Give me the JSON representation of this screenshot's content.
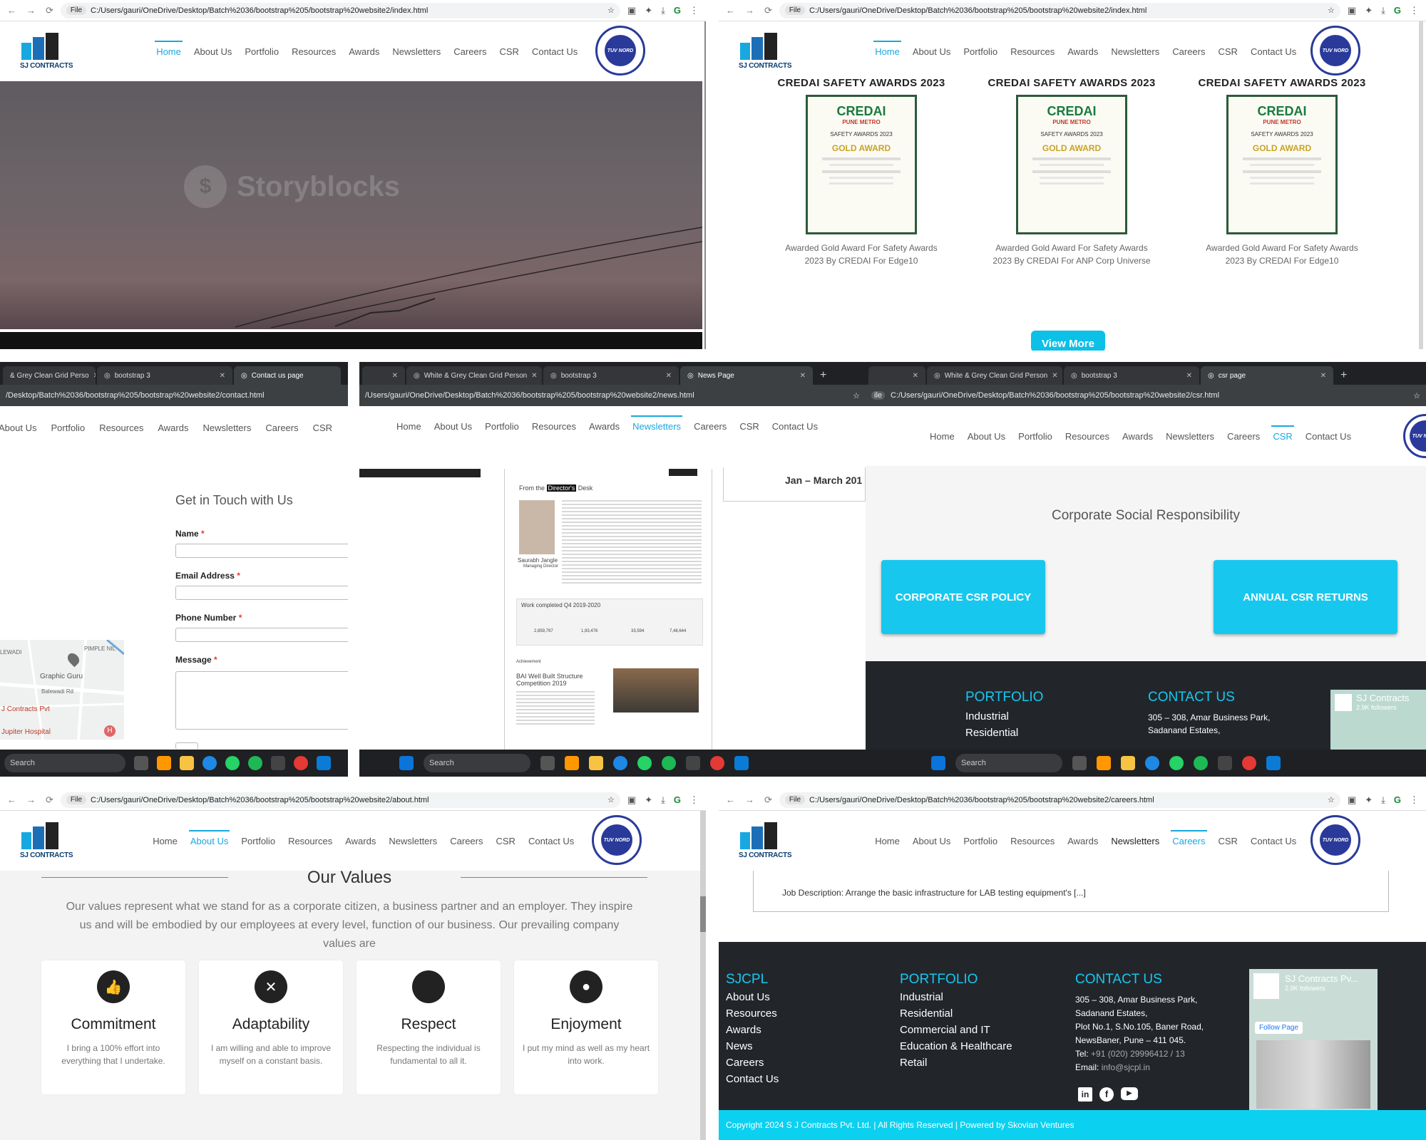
{
  "chrome": {
    "index_url": "C:/Users/gauri/OneDrive/Desktop/Batch%2036/bootstrap%205/bootstrap%20website2/index.html",
    "contact_url": "/Desktop/Batch%2036/bootstrap%205/bootstrap%20website2/contact.html",
    "news_url": "/Users/gauri/OneDrive/Desktop/Batch%2036/bootstrap%205/bootstrap%20website2/news.html",
    "csr_url": "C:/Users/gauri/OneDrive/Desktop/Batch%2036/bootstrap%205/bootstrap%20website2/csr.html",
    "about_url": "C:/Users/gauri/OneDrive/Desktop/Batch%2036/bootstrap%205/bootstrap%20website2/about.html",
    "careers_url": "C:/Users/gauri/OneDrive/Desktop/Batch%2036/bootstrap%205/bootstrap%20website2/careers.html",
    "file_chip": "File",
    "ext_initial": "G",
    "tab_grid": "White & Grey Clean Grid Person",
    "tab_grid_short": "& Grey Clean Grid Perso",
    "tab_bootstrap": "bootstrap 3",
    "tab_contact": "Contact us page",
    "tab_news": "News Page",
    "tab_csr": "csr page",
    "url_prefix_ile": "ile"
  },
  "site": {
    "logo_text": "SJ CONTRACTS",
    "tuv_label": "TUV NORD",
    "nav": [
      "Home",
      "About Us",
      "Portfolio",
      "Resources",
      "Awards",
      "Newsletters",
      "Careers",
      "CSR",
      "Contact Us"
    ]
  },
  "hero": {
    "watermark": "Storyblocks"
  },
  "awards": {
    "items": [
      {
        "title": "CREDAI SAFETY AWARDS 2023",
        "caption": "Awarded Gold Award For Safety Awards 2023 By CREDAI For Edge10"
      },
      {
        "title": "CREDAI SAFETY AWARDS 2023",
        "caption": "Awarded Gold Award For Safety Awards 2023 By CREDAI For ANP Corp Universe"
      },
      {
        "title": "CREDAI SAFETY AWARDS 2023",
        "caption": "Awarded Gold Award For Safety Awards 2023 By CREDAI For Edge10"
      }
    ],
    "cert": {
      "brand": "CREDAI",
      "sub": "PUNE METRO",
      "line": "SAFETY AWARDS 2023",
      "award": "GOLD AWARD"
    },
    "view_more": "View More"
  },
  "contact": {
    "heading": "Get in Touch with Us",
    "fields": [
      "Name",
      "Email Address",
      "Phone Number",
      "Message"
    ],
    "req": "*",
    "map": {
      "l1": "LEWADI",
      "l2": "PIMPLE NIL",
      "l3": "Graphic Guru",
      "l4": "Balewadi Rd",
      "l5": "J Contracts Pvt",
      "l6": "Jupiter Hospital"
    }
  },
  "news": {
    "partial_title": "Jan – March 201",
    "from_the": "From the",
    "directors": "Director's",
    "desk": "Desk",
    "person": "Saurabh Jangle",
    "role": "Managing Director",
    "work_completed": "Work completed Q4 2019-2020",
    "achievement": "Achievement",
    "bai": "BAI Well Built Structure Competition 2019",
    "stats": [
      "2,859,797",
      "1,93,476",
      "33,594",
      "7,48,644"
    ]
  },
  "csr": {
    "heading": "Corporate Social Responsibility",
    "btn1": "CORPORATE CSR POLICY",
    "btn2": "ANNUAL CSR RETURNS",
    "portfolio": "PORTFOLIO",
    "contact": "CONTACT US",
    "items": [
      "Industrial",
      "Residential"
    ],
    "addr": [
      "305 – 308, Amar Business Park,",
      "Sadanand Estates,"
    ],
    "fb_name": "SJ Contracts",
    "fb_followers": "2.9K followers"
  },
  "about": {
    "heading": "Our Values",
    "intro": "Our values represent what we stand for as a corporate citizen, a business partner and an employer. They inspire us and will be embodied by our employees at every level, function of our business. Our prevailing company values are",
    "values": [
      {
        "title": "Commitment",
        "text": "I bring a 100% effort into everything that I undertake."
      },
      {
        "title": "Adaptability",
        "text": "I am willing and able to improve myself on a constant basis."
      },
      {
        "title": "Respect",
        "text": "Respecting the individual is fundamental to all it."
      },
      {
        "title": "Enjoyment",
        "text": "I put my mind as well as my heart into work."
      }
    ]
  },
  "careers": {
    "job": "Job Description: Arrange the basic infrastructure for LAB testing equipment's [...]",
    "sjcpl": "SJCPL",
    "sjcpl_links": [
      "About Us",
      "Resources",
      "Awards",
      "News",
      "Careers",
      "Contact Us"
    ],
    "portfolio": "PORTFOLIO",
    "portfolio_links": [
      "Industrial",
      "Residential",
      "Commercial and IT",
      "Education & Healthcare",
      "Retail"
    ],
    "contact": "CONTACT US",
    "address": [
      "305 – 308, Amar Business Park,",
      "Sadanand Estates,",
      "Plot No.1, S.No.105, Baner Road,",
      "NewsBaner, Pune – 411 045."
    ],
    "tel_label": "Tel:",
    "tel": "+91 (020) 29996412 / 13",
    "email_label": "Email:",
    "email": "info@sjcpl.in",
    "fb_name": "SJ Contracts Pv...",
    "fb_followers": "2.9K followers",
    "follow": "Follow Page",
    "copyright": "Copyright 2024 S J Contracts Pvt. Ltd. | All Rights Reserved | Powered by Skovian Ventures"
  },
  "taskbar": {
    "search": "Search"
  },
  "colors": {
    "accent": "#18a8e0",
    "cyan": "#18c7ee",
    "footer": "#22262b",
    "copyright_bar": "#0cd0f0"
  }
}
